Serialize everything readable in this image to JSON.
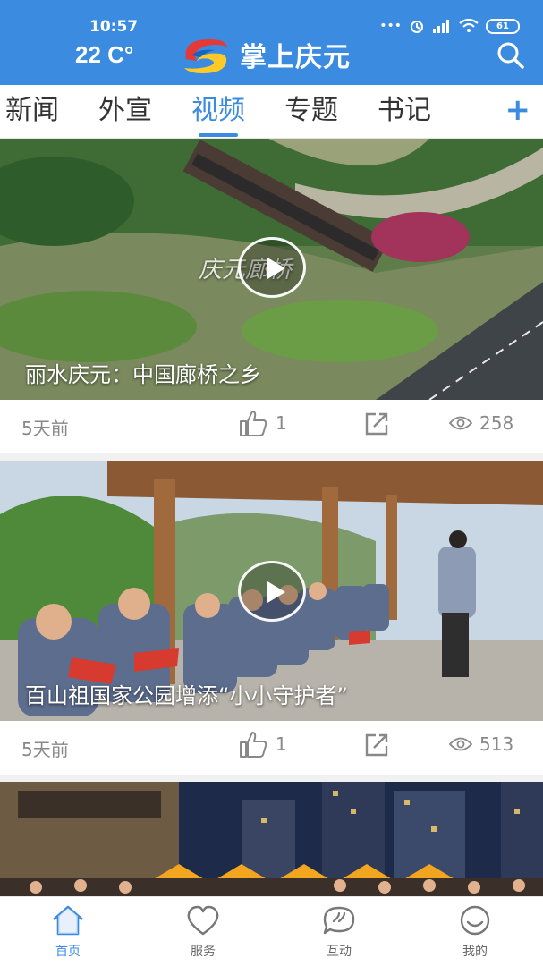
{
  "status_bar": {
    "time": "10:57",
    "battery": "61"
  },
  "header": {
    "weather": "22 C°",
    "app_name": "掌上庆元",
    "search_icon": "search-icon"
  },
  "tabs": [
    {
      "label": "新闻",
      "active": false
    },
    {
      "label": "外宣",
      "active": false
    },
    {
      "label": "视频",
      "active": true
    },
    {
      "label": "专题",
      "active": false
    },
    {
      "label": "书记",
      "active": false
    }
  ],
  "tab_add_label": "+",
  "feed": [
    {
      "title": "丽水庆元：中国廊桥之乡",
      "overlay_text": "庆元廊桥",
      "time": "5天前",
      "likes": "1",
      "views": "258"
    },
    {
      "title": "百山祖国家公园增添“小小守护者”",
      "time": "5天前",
      "likes": "1",
      "views": "513"
    }
  ],
  "bottom_nav": [
    {
      "label": "首页",
      "icon": "home-icon",
      "active": true
    },
    {
      "label": "服务",
      "icon": "heart-icon",
      "active": false
    },
    {
      "label": "互动",
      "icon": "chat-icon",
      "active": false
    },
    {
      "label": "我的",
      "icon": "smile-icon",
      "active": false
    }
  ],
  "colors": {
    "brand": "#3b8be0",
    "text": "#333333",
    "muted": "#888888"
  }
}
